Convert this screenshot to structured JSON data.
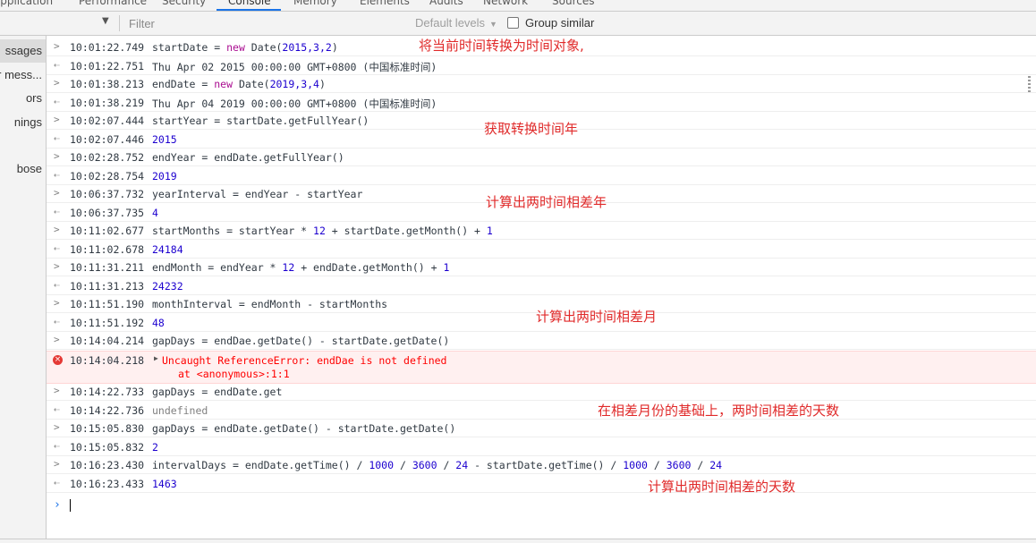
{
  "tabs": [
    "Application",
    "Performance",
    "Security",
    "Console",
    "Memory",
    "Elements",
    "Network",
    "Audits",
    "Sources"
  ],
  "toolbar": {
    "filter_placeholder": "Filter",
    "levels_label": "Default levels",
    "group_label": "Group similar"
  },
  "sidebar": {
    "items": [
      "ssages",
      "r mess...",
      "ors",
      "nings",
      "",
      "bose"
    ]
  },
  "console": {
    "rows": [
      {
        "kind": "in",
        "ts": "10:01:22.749",
        "pre": "startDate = ",
        "kw": "new",
        "post": " Date(",
        "nums": "2015,3,2",
        "end": ")"
      },
      {
        "kind": "out",
        "ts": "10:01:22.751",
        "text": "Thu Apr 02 2015 00:00:00 GMT+0800 (中国标准时间)"
      },
      {
        "kind": "in",
        "ts": "10:01:38.213",
        "pre": "endDate = ",
        "kw": "new",
        "post": " Date(",
        "nums": "2019,3,4",
        "end": ")"
      },
      {
        "kind": "out",
        "ts": "10:01:38.219",
        "text": "Thu Apr 04 2019 00:00:00 GMT+0800 (中国标准时间)"
      },
      {
        "kind": "in",
        "ts": "10:02:07.444",
        "text": "startYear = startDate.getFullYear()"
      },
      {
        "kind": "outnum",
        "ts": "10:02:07.446",
        "text": "2015"
      },
      {
        "kind": "in",
        "ts": "10:02:28.752",
        "text": "endYear = endDate.getFullYear()"
      },
      {
        "kind": "outnum",
        "ts": "10:02:28.754",
        "text": "2019"
      },
      {
        "kind": "in",
        "ts": "10:06:37.732",
        "text": "yearInterval = endYear - startYear"
      },
      {
        "kind": "outnum",
        "ts": "10:06:37.735",
        "text": "4"
      },
      {
        "kind": "in",
        "ts": "10:11:02.677",
        "text": "startMonths = startYear * 12 + startDate.getMonth() + 1"
      },
      {
        "kind": "outnum",
        "ts": "10:11:02.678",
        "text": "24184"
      },
      {
        "kind": "in",
        "ts": "10:11:31.211",
        "text": "endMonth = endYear * 12 + endDate.getMonth() + 1"
      },
      {
        "kind": "outnum",
        "ts": "10:11:31.213",
        "text": "24232"
      },
      {
        "kind": "in",
        "ts": "10:11:51.190",
        "text": "monthInterval = endMonth - startMonths"
      },
      {
        "kind": "outnum",
        "ts": "10:11:51.192",
        "text": "48"
      },
      {
        "kind": "in",
        "ts": "10:14:04.214",
        "text": "gapDays = endDae.getDate() - startDate.getDate()"
      },
      {
        "kind": "error",
        "ts": "10:14:04.218",
        "text": "Uncaught ReferenceError: endDae is not defined",
        "text2": "at <anonymous>:1:1"
      },
      {
        "kind": "in",
        "ts": "10:14:22.733",
        "text": "gapDays = endDate.get"
      },
      {
        "kind": "outundef",
        "ts": "10:14:22.736",
        "text": "undefined"
      },
      {
        "kind": "in",
        "ts": "10:15:05.830",
        "text": "gapDays = endDate.getDate() - startDate.getDate()"
      },
      {
        "kind": "outnum",
        "ts": "10:15:05.832",
        "text": "2"
      },
      {
        "kind": "in",
        "ts": "10:16:23.430",
        "text": "intervalDays = endDate.getTime() / 1000 / 3600 / 24 - startDate.getTime() / 1000 / 3600 / 24"
      },
      {
        "kind": "outnum",
        "ts": "10:16:23.433",
        "text": "1463"
      }
    ]
  },
  "notes": [
    "将当前时间转换为时间对象,",
    "获取转换时间年",
    "计算出两时间相差年",
    "计算出两时间相差月",
    "在相差月份的基础上，两时间相差的天数",
    "计算出两时间相差的天数"
  ],
  "icons": {
    "input_marker": "chevron-right",
    "output_marker": "return-arrow",
    "error_marker": "error-circle"
  },
  "colors": {
    "accent": "#1a73e8",
    "error": "#ff0000",
    "number": "#1c00cf",
    "keyword": "#aa0d91",
    "annotation": "#e02a2a"
  }
}
